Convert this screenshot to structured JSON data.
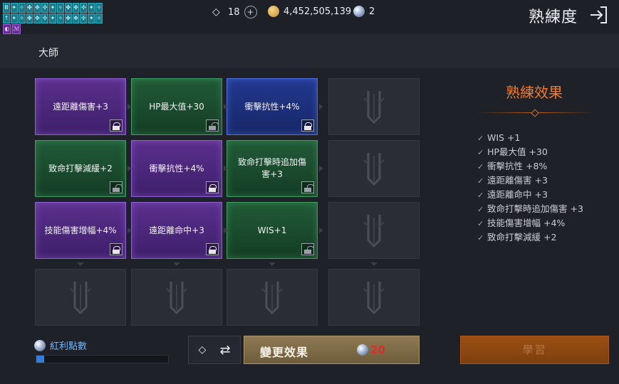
{
  "header": {
    "title": "熟練度",
    "tab_label": "大師",
    "diamonds": "18",
    "gold": "4,452,505,139",
    "orbs": "2"
  },
  "buffs": {
    "row1": [
      "Ⅲ",
      "✦",
      "✧",
      "✤",
      "✥",
      "✣",
      "✦",
      "✧",
      "✤",
      "✥",
      "✣",
      "✦",
      "✧"
    ],
    "row2": [
      "↑",
      "✦",
      "✧",
      "✤",
      "✥",
      "✣",
      "✦",
      "✧",
      "✤",
      "✥",
      "✣",
      "✦",
      "✧"
    ],
    "row3": [
      "◐",
      "ℳ"
    ]
  },
  "grid": {
    "cards": [
      {
        "label": "遠距離傷害+3",
        "color": "purple",
        "lock": "locked"
      },
      {
        "label": "HP最大值+30",
        "color": "green",
        "lock": "open"
      },
      {
        "label": "衝擊抗性+4%",
        "color": "blue",
        "lock": "locked"
      },
      {
        "label": "",
        "color": "empty",
        "lock": "none"
      },
      {
        "label": "致命打擊減緩+2",
        "color": "green",
        "lock": "open"
      },
      {
        "label": "衝擊抗性+4%",
        "color": "purple",
        "lock": "locked"
      },
      {
        "label": "致命打擊時追加傷害+3",
        "color": "green",
        "lock": "open"
      },
      {
        "label": "",
        "color": "empty",
        "lock": "none"
      },
      {
        "label": "技能傷害增幅+4%",
        "color": "purple",
        "lock": "locked"
      },
      {
        "label": "遠距離命中+3",
        "color": "purple",
        "lock": "locked"
      },
      {
        "label": "WIS+1",
        "color": "green",
        "lock": "open"
      },
      {
        "label": "",
        "color": "empty",
        "lock": "none"
      },
      {
        "label": "",
        "color": "empty",
        "lock": "none"
      },
      {
        "label": "",
        "color": "empty",
        "lock": "none"
      },
      {
        "label": "",
        "color": "empty",
        "lock": "none"
      },
      {
        "label": "",
        "color": "empty",
        "lock": "none"
      }
    ]
  },
  "effects": {
    "title": "熟練效果",
    "items": [
      "WIS +1",
      "HP最大值 +30",
      "衝擊抗性 +8%",
      "遠距離傷害 +3",
      "遠距離命中 +3",
      "致命打擊時追加傷害 +3",
      "技能傷害增幅 +4%",
      "致命打擊減緩 +2"
    ]
  },
  "bonus": {
    "label": "紅利點數",
    "progress": 0.06
  },
  "buttons": {
    "swap_icon": "⇄",
    "change_label": "變更效果",
    "change_cost": "20",
    "learn_label": "學習"
  },
  "colors": {
    "accent_orange": "#f27a28",
    "bonus_blue": "#2e7ee0",
    "cost_red": "#e22a2a"
  }
}
